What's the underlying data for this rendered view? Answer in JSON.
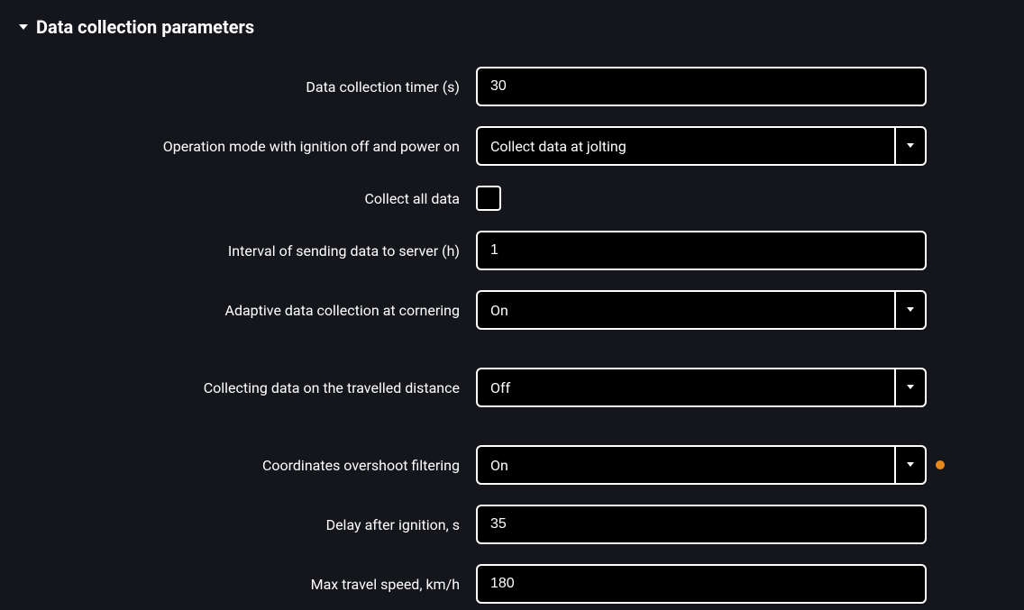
{
  "section": {
    "title": "Data collection parameters"
  },
  "fields": {
    "timer": {
      "label": "Data collection timer (s)",
      "value": "30"
    },
    "opmode": {
      "label": "Operation mode with ignition off and power on",
      "value": "Collect data at jolting"
    },
    "collect_all": {
      "label": "Collect all data"
    },
    "interval": {
      "label": "Interval of sending data to server (h)",
      "value": "1"
    },
    "adaptive": {
      "label": "Adaptive data collection at cornering",
      "value": "On"
    },
    "travelled": {
      "label": "Collecting data on the travelled distance",
      "value": "Off"
    },
    "overshoot": {
      "label": "Coordinates overshoot filtering",
      "value": "On"
    },
    "delay": {
      "label": "Delay after ignition, s",
      "value": "35"
    },
    "maxspeed": {
      "label": "Max travel speed, km/h",
      "value": "180"
    }
  },
  "colors": {
    "indicator": "#e88a1a"
  }
}
